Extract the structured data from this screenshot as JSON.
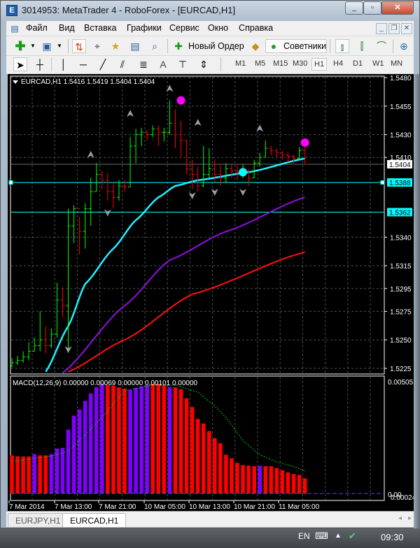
{
  "window": {
    "title": "3014953: MetaTrader 4 - RoboForex - [EURCAD,H1]",
    "icon": "mt4-app-icon"
  },
  "menu": [
    "Файл",
    "Вид",
    "Вставка",
    "Графики",
    "Сервис",
    "Окно",
    "Справка"
  ],
  "toolbar": {
    "new_order": "Новый Ордер",
    "experts": "Советники"
  },
  "drawtools": {
    "text_tool": "A"
  },
  "timeframes": [
    "M1",
    "M5",
    "M15",
    "M30",
    "H1",
    "H4",
    "D1",
    "W1",
    "MN"
  ],
  "active_timeframe": "H1",
  "chart": {
    "header": "EURCAD,H1  1.5416 1.5419 1.5404 1.5404",
    "price_labels": [
      "1.5480",
      "1.5455",
      "1.5430",
      "1.5410",
      "1.5340",
      "1.5315",
      "1.5295",
      "1.5275",
      "1.5250",
      "1.5225"
    ],
    "bid_label": "1.5404",
    "bid_price": 1.5404,
    "hlines": [
      {
        "price": 1.5388,
        "label": "1.5388",
        "color": "#00ffff"
      },
      {
        "price": 1.5362,
        "label": "1.5362",
        "color": "#00ffff"
      }
    ],
    "closes": [
      1.523,
      1.5232,
      1.5235,
      1.524,
      1.5245,
      1.525,
      1.5245,
      1.5255,
      1.5285,
      1.528,
      1.535,
      1.5365,
      1.5345,
      1.5365,
      1.538,
      1.5395,
      1.539,
      1.538,
      1.5375,
      1.5385,
      1.5384,
      1.542,
      1.543,
      1.5432,
      1.543,
      1.5435,
      1.5432,
      1.5432,
      1.544,
      1.543,
      1.5425,
      1.54,
      1.5395,
      1.5385,
      1.5395,
      1.54,
      1.5395,
      1.5392,
      1.54,
      1.5398,
      1.5397,
      1.5398,
      1.5392,
      1.5405,
      1.541,
      1.5418,
      1.5416,
      1.5414,
      1.5412,
      1.5411,
      1.5409,
      1.5416,
      1.5404
    ],
    "highs": [
      1.5234,
      1.5236,
      1.524,
      1.5248,
      1.5252,
      1.5275,
      1.5262,
      1.526,
      1.53,
      1.5296,
      1.5365,
      1.5368,
      1.5358,
      1.537,
      1.5392,
      1.5405,
      1.5398,
      1.5396,
      1.5388,
      1.539,
      1.539,
      1.5428,
      1.5435,
      1.5436,
      1.5434,
      1.5438,
      1.5438,
      1.5436,
      1.546,
      1.5452,
      1.5442,
      1.5425,
      1.5408,
      1.5402,
      1.542,
      1.5418,
      1.5408,
      1.5403,
      1.5405,
      1.5404,
      1.5403,
      1.5404,
      1.54,
      1.5408,
      1.5414,
      1.5425,
      1.542,
      1.5418,
      1.5416,
      1.5414,
      1.5412,
      1.5419,
      1.5419
    ],
    "lows": [
      1.5226,
      1.5228,
      1.523,
      1.5232,
      1.524,
      1.524,
      1.5238,
      1.5243,
      1.5252,
      1.527,
      1.524,
      1.5335,
      1.5325,
      1.533,
      1.535,
      1.538,
      1.5382,
      1.5372,
      1.5365,
      1.5372,
      1.538,
      1.5384,
      1.5405,
      1.542,
      1.5425,
      1.5428,
      1.542,
      1.5424,
      1.543,
      1.5418,
      1.541,
      1.5395,
      1.5382,
      1.538,
      1.5384,
      1.5392,
      1.5388,
      1.5385,
      1.5388,
      1.5392,
      1.539,
      1.5392,
      1.5385,
      1.5392,
      1.5402,
      1.541,
      1.5412,
      1.541,
      1.5408,
      1.5406,
      1.5405,
      1.5408,
      1.5404
    ],
    "ma_cyan": [
      [
        6,
        1.5222
      ],
      [
        10,
        1.5262
      ],
      [
        13,
        1.5299
      ],
      [
        18,
        1.533
      ],
      [
        22,
        1.5355
      ],
      [
        26,
        1.5375
      ],
      [
        29,
        1.5385
      ],
      [
        33,
        1.539
      ],
      [
        42,
        1.5397
      ],
      [
        52,
        1.5409
      ]
    ],
    "ma_purple": [
      [
        9,
        1.5221
      ],
      [
        20,
        1.528
      ],
      [
        28,
        1.532
      ],
      [
        38,
        1.5345
      ],
      [
        52,
        1.5375
      ]
    ],
    "ma_red": [
      [
        10,
        1.5222
      ],
      [
        20,
        1.525
      ],
      [
        32,
        1.529
      ],
      [
        52,
        1.5327
      ]
    ],
    "arrows_up": [
      [
        14,
        1.5412
      ],
      [
        21,
        1.5448
      ],
      [
        28,
        1.547
      ],
      [
        33,
        1.544
      ],
      [
        44,
        1.5435
      ]
    ],
    "arrows_down": [
      [
        10,
        1.5242
      ],
      [
        17,
        1.5362
      ],
      [
        32,
        1.5377
      ],
      [
        36,
        1.538
      ],
      [
        41,
        1.538
      ]
    ],
    "dots": [
      {
        "bar": 30,
        "price": 1.546,
        "color": "#ff00ff"
      },
      {
        "bar": 52,
        "price": 1.5423,
        "color": "#ff00ff"
      },
      {
        "bar": 41,
        "price": 1.5397,
        "color": "#00ffff"
      }
    ]
  },
  "macd": {
    "header": "MACD(12,26,9) 0.00000 0.00069 0.00000 0.00101 0.00000",
    "scale_top": "0.00505",
    "scale_bottom": "0.00024",
    "scale_zero": "0.00",
    "values": [
      0.00172,
      0.00168,
      0.00167,
      0.00167,
      0.00178,
      0.00172,
      0.00172,
      0.00178,
      0.00203,
      0.00206,
      0.00288,
      0.00351,
      0.00379,
      0.00418,
      0.00452,
      0.00481,
      0.00495,
      0.00489,
      0.00487,
      0.00479,
      0.00474,
      0.00468,
      0.00477,
      0.00484,
      0.00489,
      0.00495,
      0.00495,
      0.00489,
      0.00481,
      0.00479,
      0.00471,
      0.0043,
      0.0039,
      0.00337,
      0.00316,
      0.00282,
      0.0025,
      0.00227,
      0.00175,
      0.00159,
      0.00138,
      0.00128,
      0.00126,
      0.00123,
      0.00125,
      0.00123,
      0.00123,
      0.00115,
      0.00105,
      0.00095,
      0.00088,
      0.00084,
      0.00068
    ],
    "purple_bars": [
      4,
      7,
      8,
      9,
      10,
      11,
      12,
      13,
      14,
      15,
      16,
      21,
      22,
      23,
      24,
      28,
      44
    ],
    "signal": [
      [
        0,
        0.00144
      ],
      [
        7,
        0.00169
      ],
      [
        10,
        0.0019
      ],
      [
        14,
        0.0029
      ],
      [
        17,
        0.00374
      ],
      [
        20,
        0.00463
      ],
      [
        25,
        0.00489
      ],
      [
        29,
        0.00489
      ],
      [
        33,
        0.00458
      ],
      [
        36,
        0.00395
      ],
      [
        38,
        0.00343
      ],
      [
        41,
        0.00238
      ],
      [
        44,
        0.00175
      ],
      [
        47,
        0.00143
      ],
      [
        50,
        0.00122
      ],
      [
        52,
        0.00102
      ]
    ],
    "max": 0.00505
  },
  "time_labels": [
    "7 Mar 2014",
    "7 Mar 13:00",
    "7 Mar 21:00",
    "10 Mar 05:00",
    "10 Mar 13:00",
    "10 Mar 21:00",
    "11 Mar 05:00"
  ],
  "tabs": [
    {
      "label": "EURJPY,H1"
    },
    {
      "label": "EURCAD,H1"
    }
  ],
  "taskbar": {
    "lang": "EN",
    "clock": "09:30"
  },
  "colors": {
    "bull": "#00ff00",
    "bear": "#ff0000",
    "macd_purple": "#8000ff",
    "macd_red": "#ff0000",
    "signal": "#00cc00",
    "grid": "#4a5058"
  }
}
